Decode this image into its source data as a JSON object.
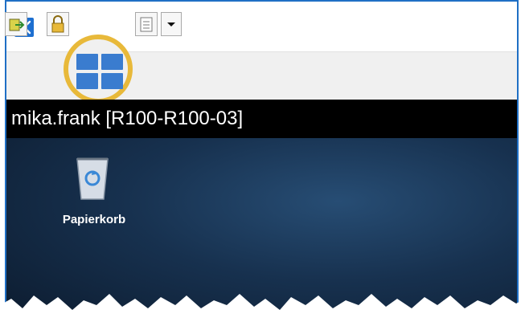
{
  "window": {
    "session_title": "mika.frank [R100-R100-03]"
  },
  "toolbar": {
    "buttons": [
      {
        "icon": "fit-window-icon"
      },
      {
        "icon": "lock-icon"
      },
      {
        "icon": "multi-monitor-icon"
      },
      {
        "icon": "monitor-list-icon"
      },
      {
        "icon": "dropdown-arrow-icon"
      }
    ]
  },
  "desktop": {
    "icons": [
      {
        "label": "Papierkorb",
        "icon": "recycle-bin-icon"
      }
    ]
  },
  "colors": {
    "window_border": "#1f6fc5",
    "highlight_ring": "#e8b93a",
    "tile_blue": "#3a7ccf",
    "session_bar": "#000000"
  }
}
